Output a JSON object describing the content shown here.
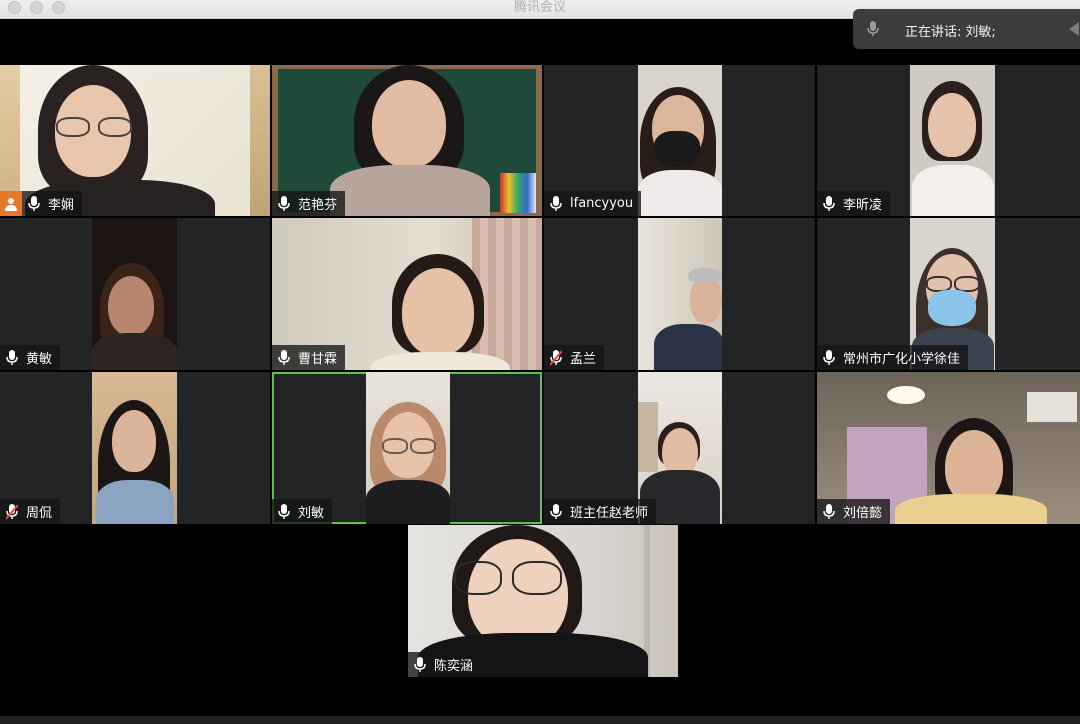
{
  "window": {
    "title": "腾讯会议"
  },
  "speaking": {
    "prefix": "正在讲话:",
    "names": "刘敏;"
  },
  "participants": [
    {
      "name": "李娴",
      "mic": "on",
      "host_icon": true
    },
    {
      "name": "范艳芬",
      "mic": "on"
    },
    {
      "name": "lfancyyou",
      "mic": "on"
    },
    {
      "name": "李昕凌",
      "mic": "on"
    },
    {
      "name": "黄敏",
      "mic": "on"
    },
    {
      "name": "曹甘霖",
      "mic": "on"
    },
    {
      "name": "孟兰",
      "mic": "muted"
    },
    {
      "name": "常州市广化小学徐佳",
      "mic": "on"
    },
    {
      "name": "周侃",
      "mic": "muted"
    },
    {
      "name": "刘敏",
      "mic": "on",
      "active_speaker": true
    },
    {
      "name": "班主任赵老师",
      "mic": "on"
    },
    {
      "name": "刘倍懿",
      "mic": "on"
    },
    {
      "name": "陈奕涵",
      "mic": "on"
    }
  ],
  "colors": {
    "active_border": "#59c34a",
    "muted": "#e74c3c",
    "host_badge": "#e8772a"
  }
}
